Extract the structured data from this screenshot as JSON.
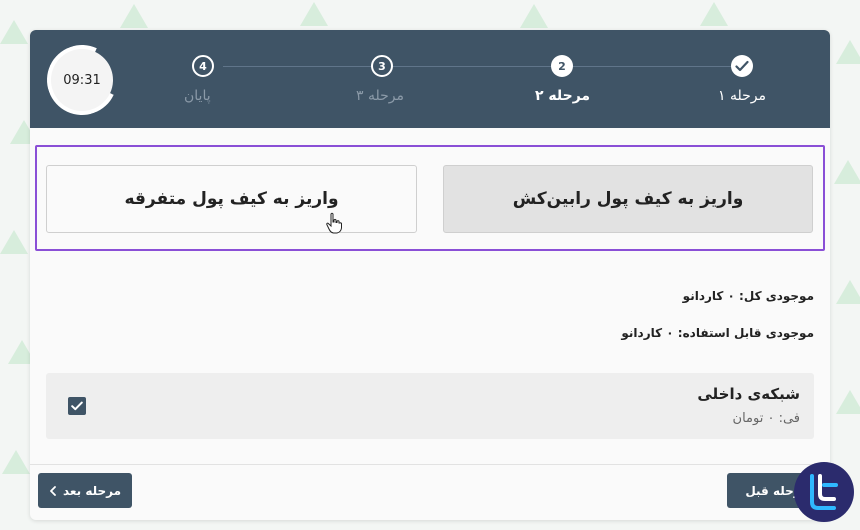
{
  "timer": "09:31",
  "steps": [
    {
      "num": "",
      "label": "مرحله ۱",
      "state": "done"
    },
    {
      "num": "2",
      "label": "مرحله ۲",
      "state": "active"
    },
    {
      "num": "3",
      "label": "مرحله ۳",
      "state": "pending"
    },
    {
      "num": "4",
      "label": "پایان",
      "state": "pending"
    }
  ],
  "options": {
    "rabincash": "واریز به کیف پول رابین‌کش",
    "other": "واریز به کیف پول متفرقه"
  },
  "balance": {
    "total": "موجودی کل: ۰ کاردانو",
    "available": "موجودی قابل استفاده: ۰ کاردانو"
  },
  "network": {
    "title": "شبکه‌ی داخلی",
    "fee": "فی: ۰ تومان",
    "checked": true
  },
  "nav": {
    "prev": "مرحله قبل",
    "next": "مرحله بعد"
  },
  "colors": {
    "header": "#3f5466",
    "highlight": "#8a4fd6",
    "logo": "#2b2b6d",
    "logo_accent": "#2fb8ff"
  }
}
